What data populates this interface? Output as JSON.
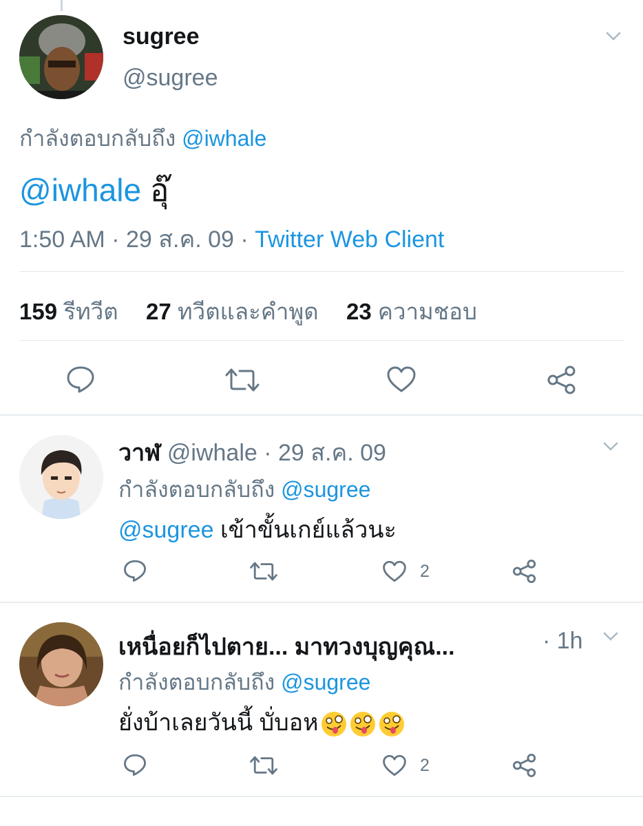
{
  "main_tweet": {
    "display_name": "sugree",
    "handle": "@sugree",
    "replying_prefix": "กำลังตอบกลับถึง",
    "replying_handle": "@iwhale",
    "text_mention": "@iwhale",
    "text_body": "อุ๊",
    "time": "1:50 AM",
    "dot": "·",
    "date": "29 ส.ค. 09",
    "client": "Twitter Web Client",
    "stats": {
      "retweets_count": "159",
      "retweets_label": "รีทวีต",
      "quotes_count": "27",
      "quotes_label": "ทวีตและคำพูด",
      "likes_count": "23",
      "likes_label": "ความชอบ"
    },
    "actions": [
      "reply-icon",
      "retweet-icon",
      "like-icon",
      "share-icon"
    ]
  },
  "replies": [
    {
      "display_name": "วาฬ",
      "handle": "@iwhale",
      "meta": "· 29 ส.ค. 09",
      "replying_prefix": "กำลังตอบกลับถึง",
      "replying_handle": "@sugree",
      "text_mention": "@sugree",
      "text_body": "เข้าขั้นเกย์แล้วนะ",
      "like_count": "2"
    },
    {
      "display_name": "เหนื่อยก็ไปตาย... มาทวงบุญคุณ...",
      "meta": "· 1h",
      "replying_prefix": "กำลังตอบกลับถึง",
      "replying_handle": "@sugree",
      "text_body": "ยั่งบ้าเลยวันนี้ บั่บอห",
      "emojis": [
        "zany-face-emoji",
        "zany-face-emoji",
        "zany-face-emoji"
      ],
      "like_count": "2"
    }
  ],
  "colors": {
    "link": "#1b95e0",
    "secondary": "#657786",
    "divider": "#e1e8ed"
  }
}
